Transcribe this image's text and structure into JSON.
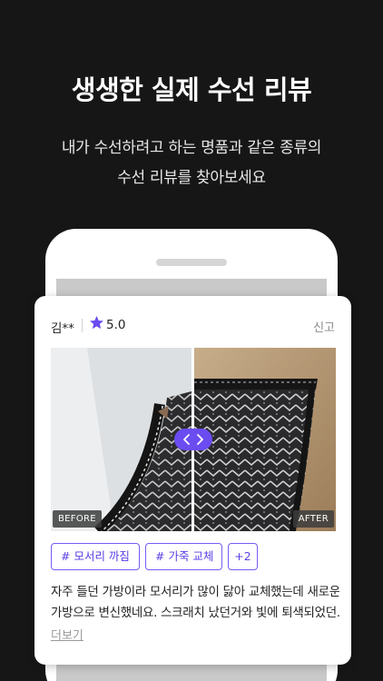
{
  "headline": "생생한 실제 수선 리뷰",
  "subline_1": "내가 수선하려고 하는 명품과 같은 종류의",
  "subline_2": "수선 리뷰를 찾아보세요",
  "review": {
    "reviewer": "김**",
    "rating": "5.0",
    "report_label": "신고",
    "before_label": "BEFORE",
    "after_label": "AFTER",
    "tags": [
      "# 모서리 까짐",
      "# 가죽 교체",
      "+2"
    ],
    "text_line_1": "자주 들던 가방이라 모서리가 많이 닳아 교체했는데 새로운",
    "text_line_2": "가방으로 변신했네요. 스크래치 났던거와 빛에 퇴색되었던...",
    "more_label": "더보기"
  },
  "colors": {
    "accent": "#6a4cf0",
    "background": "#161616"
  },
  "icons": [
    "star-icon",
    "chevron-left-icon",
    "chevron-right-icon"
  ]
}
